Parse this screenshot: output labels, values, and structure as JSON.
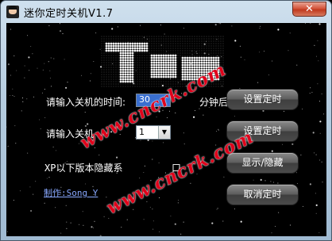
{
  "window": {
    "title": "迷你定时关机V1.7",
    "close_label": "✕"
  },
  "form": {
    "minutes_label": "请输入关机的时间:",
    "minutes_value": "30",
    "minutes_suffix": "分钟后",
    "hour_label": "请输入关机",
    "hour_value": "1",
    "hide_note": "XP以下版本隐藏系",
    "hide_note_tail": "口",
    "author": "制作:Song Y"
  },
  "buttons": {
    "set_timer_1": "设置定时",
    "set_timer_2": "设置定时",
    "show_hide": "显示/隐藏",
    "cancel": "取消定时"
  },
  "watermark": {
    "text": "www.cncrk.com"
  }
}
